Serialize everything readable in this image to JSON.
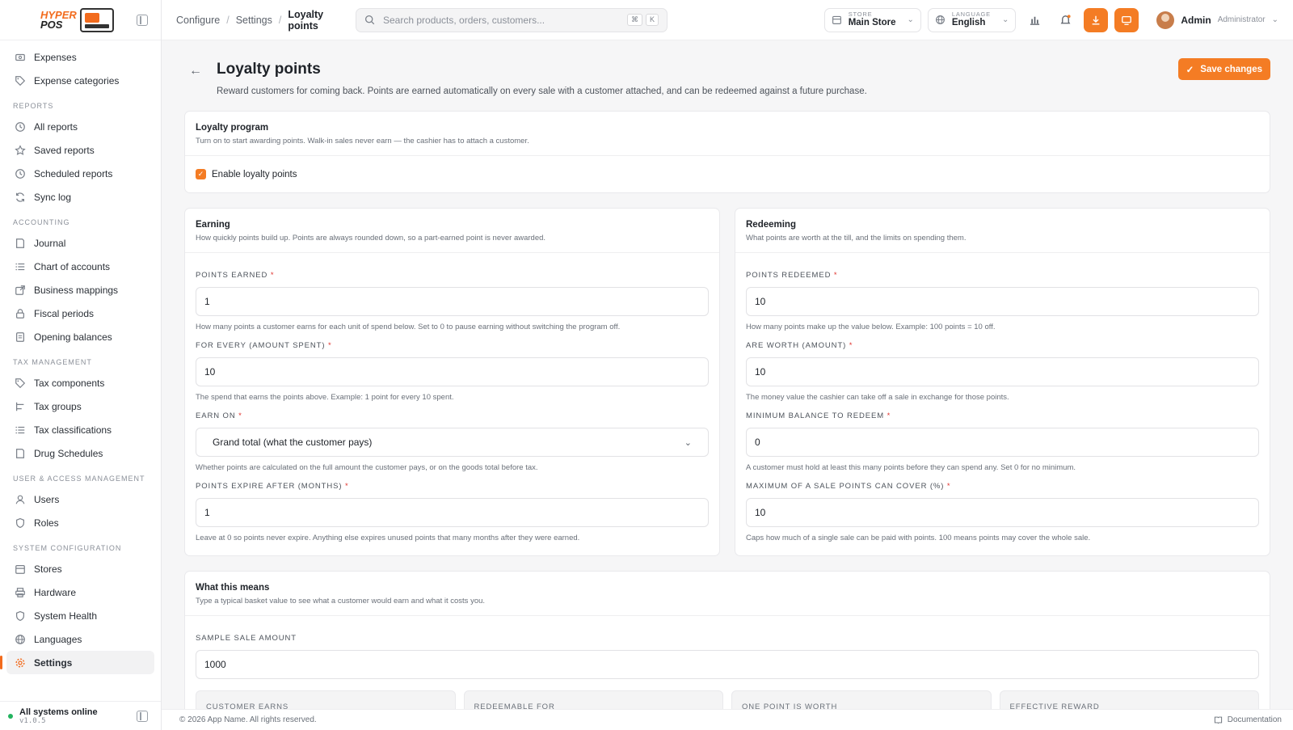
{
  "brand": {
    "line1": "HYPER",
    "line2": "POS"
  },
  "sidebar": {
    "top_items": [
      {
        "label": "Expenses",
        "icon": "cash-icon"
      },
      {
        "label": "Expense categories",
        "icon": "tag-icon"
      }
    ],
    "sections": [
      {
        "title": "REPORTS",
        "items": [
          "All reports",
          "Saved reports",
          "Scheduled reports",
          "Sync log"
        ]
      },
      {
        "title": "ACCOUNTING",
        "items": [
          "Journal",
          "Chart of accounts",
          "Business mappings",
          "Fiscal periods",
          "Opening balances"
        ]
      },
      {
        "title": "TAX MANAGEMENT",
        "items": [
          "Tax components",
          "Tax groups",
          "Tax classifications",
          "Drug Schedules"
        ]
      },
      {
        "title": "USER & ACCESS MANAGEMENT",
        "items": [
          "Users",
          "Roles"
        ]
      },
      {
        "title": "SYSTEM CONFIGURATION",
        "items": [
          "Stores",
          "Hardware",
          "System Health",
          "Languages",
          "Settings"
        ]
      }
    ],
    "active_item": "Settings",
    "status": "All systems online",
    "version": "v1.0.5"
  },
  "topbar": {
    "breadcrumb": [
      "Configure",
      "Settings",
      "Loyalty points"
    ],
    "search_placeholder": "Search products, orders, customers...",
    "search_kbd": [
      "⌘",
      "K"
    ],
    "store_caption": "STORE",
    "store_value": "Main Store",
    "language_caption": "LANGUAGE",
    "language_value": "English",
    "user_name": "Admin",
    "user_role": "Administrator"
  },
  "page": {
    "title": "Loyalty points",
    "subtitle": "Reward customers for coming back. Points are earned automatically on every sale with a customer attached, and can be redeemed against a future purchase.",
    "save_label": "Save changes"
  },
  "program": {
    "title": "Loyalty program",
    "desc": "Turn on to start awarding points. Walk-in sales never earn — the cashier has to attach a customer.",
    "checkbox_label": "Enable loyalty points",
    "enabled": true
  },
  "earning": {
    "title": "Earning",
    "desc": "How quickly points build up. Points are always rounded down, so a part-earned point is never awarded.",
    "fields": [
      {
        "label": "POINTS EARNED",
        "value": "1",
        "hint": "How many points a customer earns for each unit of spend below. Set to 0 to pause earning without switching the program off."
      },
      {
        "label": "FOR EVERY (AMOUNT SPENT)",
        "value": "10",
        "hint": "The spend that earns the points above. Example: 1 point for every 10 spent."
      },
      {
        "label": "EARN ON",
        "value": "Grand total (what the customer pays)",
        "hint": "Whether points are calculated on the full amount the customer pays, or on the goods total before tax."
      },
      {
        "label": "POINTS EXPIRE AFTER (MONTHS)",
        "value": "1",
        "hint": "Leave at 0 so points never expire. Anything else expires unused points that many months after they were earned."
      }
    ]
  },
  "redeeming": {
    "title": "Redeeming",
    "desc": "What points are worth at the till, and the limits on spending them.",
    "fields": [
      {
        "label": "POINTS REDEEMED",
        "value": "10",
        "hint": "How many points make up the value below. Example: 100 points = 10 off."
      },
      {
        "label": "ARE WORTH (AMOUNT)",
        "value": "10",
        "hint": "The money value the cashier can take off a sale in exchange for those points."
      },
      {
        "label": "MINIMUM BALANCE TO REDEEM",
        "value": "0",
        "hint": "A customer must hold at least this many points before they can spend any. Set 0 for no minimum."
      },
      {
        "label": "MAXIMUM OF A SALE POINTS CAN COVER (%)",
        "value": "10",
        "hint": "Caps how much of a single sale can be paid with points. 100 means points may cover the whole sale."
      }
    ]
  },
  "preview": {
    "title": "What this means",
    "desc": "Type a typical basket value to see what a customer would earn and what it costs you.",
    "sample_label": "SAMPLE SALE AMOUNT",
    "sample_value": "1000",
    "stats": [
      "CUSTOMER EARNS",
      "REDEEMABLE FOR",
      "ONE POINT IS WORTH",
      "EFFECTIVE REWARD"
    ]
  },
  "footer": {
    "copyright": "© 2026 App Name. All rights reserved.",
    "docs": "Documentation"
  },
  "colors": {
    "accent": "#f47c24",
    "online": "#22b35e",
    "required": "#e0342f"
  }
}
